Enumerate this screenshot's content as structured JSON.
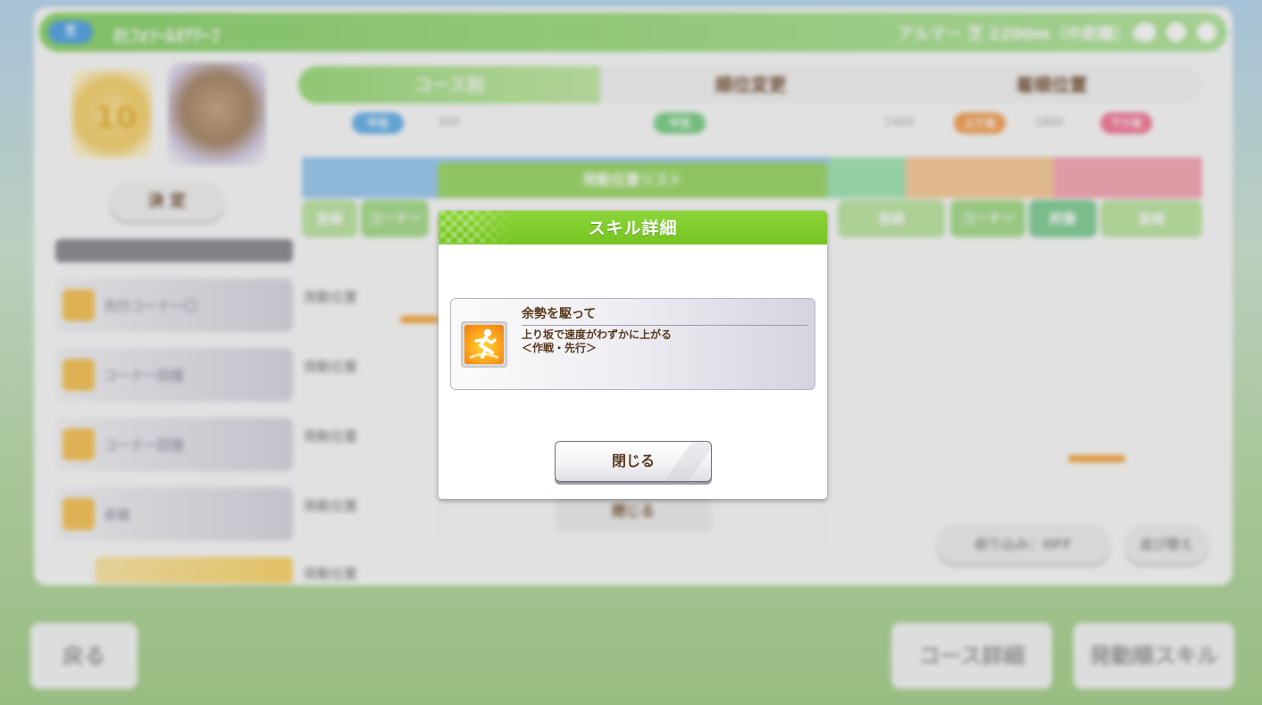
{
  "background": {
    "header_badge": "芝",
    "header_title": "ｵﾋﾌｫｿｰﾙｵｱﾃｰﾌ",
    "header_info": "アルマー 芝 2200m（中距離）右",
    "decide_label": "決 定",
    "tabs": [
      "コース別",
      "順位変更",
      "着順位置"
    ],
    "track_tags": [
      "平坦",
      "平坦",
      "上り坂",
      "下り坂"
    ],
    "track_numbers": [
      "300",
      "1400",
      "1800"
    ],
    "track_pills": [
      "直線",
      "コーナー",
      "直線",
      "直線",
      "コーナー",
      "終盤",
      "直線"
    ],
    "skill_rows": [
      "先行コーナー〇",
      "コーナー回復",
      "コーナー回復",
      "余裕",
      ""
    ],
    "row_labels": [
      "発動位置",
      "発動位置",
      "発動位置",
      "発動位置",
      "発動位置"
    ],
    "under_dialog_title": "発動位置リスト",
    "under_dialog_button": "閉じる",
    "collapse_label": "絞り込み：OFF",
    "sort_label": "並び替え",
    "back_label": "戻る",
    "course_detail_label": "コース詳細",
    "trigger_skill_label": "発動順スキル"
  },
  "dialog": {
    "title": "スキル詳細",
    "skill": {
      "name": "余勢を駆って",
      "description_line1": "上り坂で速度がわずかに上がる",
      "description_line2": "＜作戦・先行＞",
      "icon": "running-person-speed-icon"
    },
    "close_label": "閉じる"
  },
  "colors": {
    "header_green": "#7cc92a",
    "text_brown": "#5a3a1e",
    "icon_orange": "#f5a21f"
  }
}
